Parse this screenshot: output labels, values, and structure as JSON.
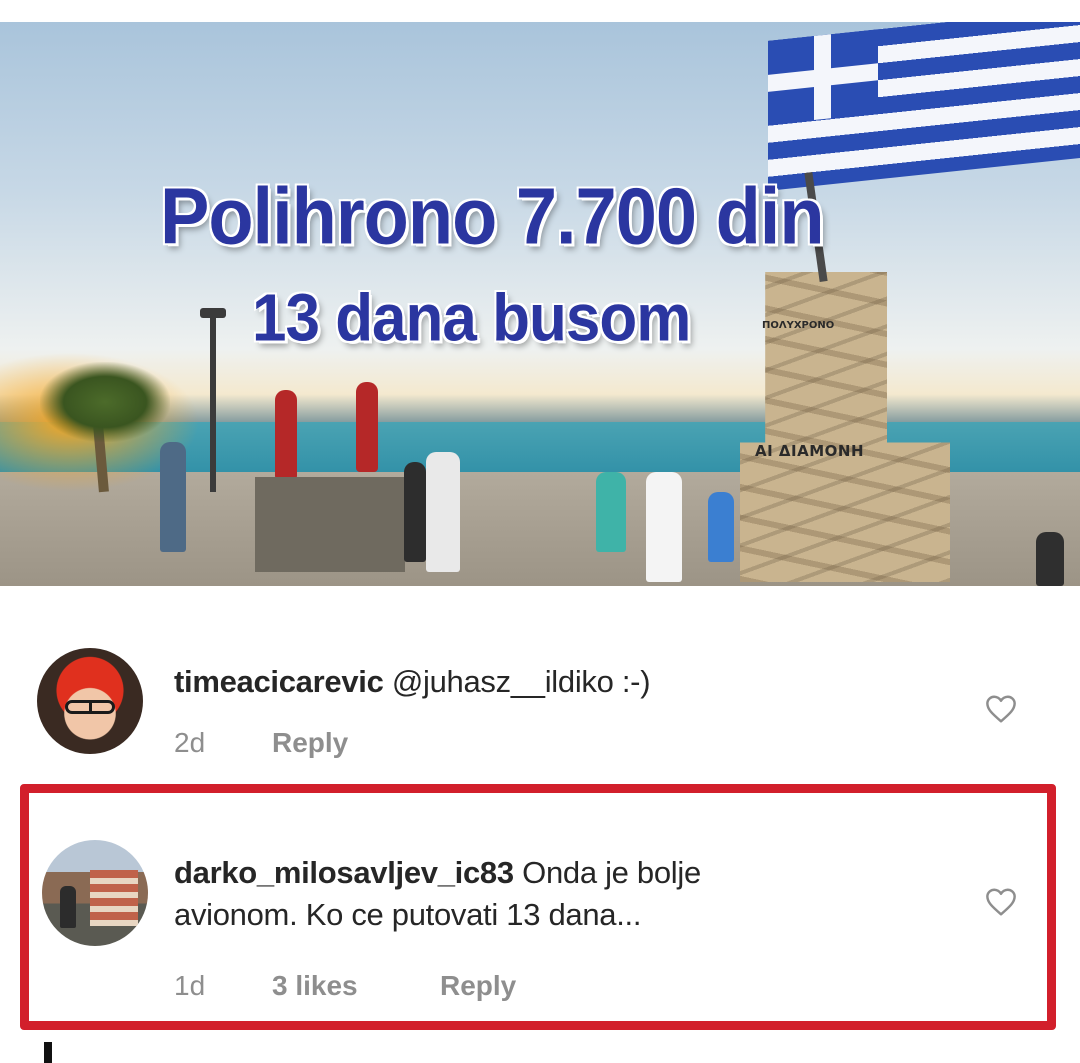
{
  "post": {
    "headline": "Polihrono 7.700 din",
    "subheadline": "13 dana busom",
    "monument_sign": "ΑΙ ΔΙΑΜΟΝΗ",
    "monument_sign_top": "ΠΟΛΥΧΡΟΝΟ"
  },
  "comments": [
    {
      "username": "timeacicarevic",
      "text": "@juhasz__ildiko :-)",
      "age": "2d",
      "likes": "",
      "reply_label": "Reply"
    },
    {
      "username": "darko_milosavljev_ic83",
      "text_line1": "Onda je bolje",
      "text_line2": "avionom. Ko ce putovati 13 dana...",
      "age": "1d",
      "likes": "3 likes",
      "reply_label": "Reply"
    }
  ],
  "colors": {
    "headline_text": "#2b36a0",
    "highlight_border": "#d21f2b",
    "meta_text": "#8e8e8e",
    "body_text": "#262626"
  },
  "icons": {
    "like": "heart-outline-icon"
  }
}
